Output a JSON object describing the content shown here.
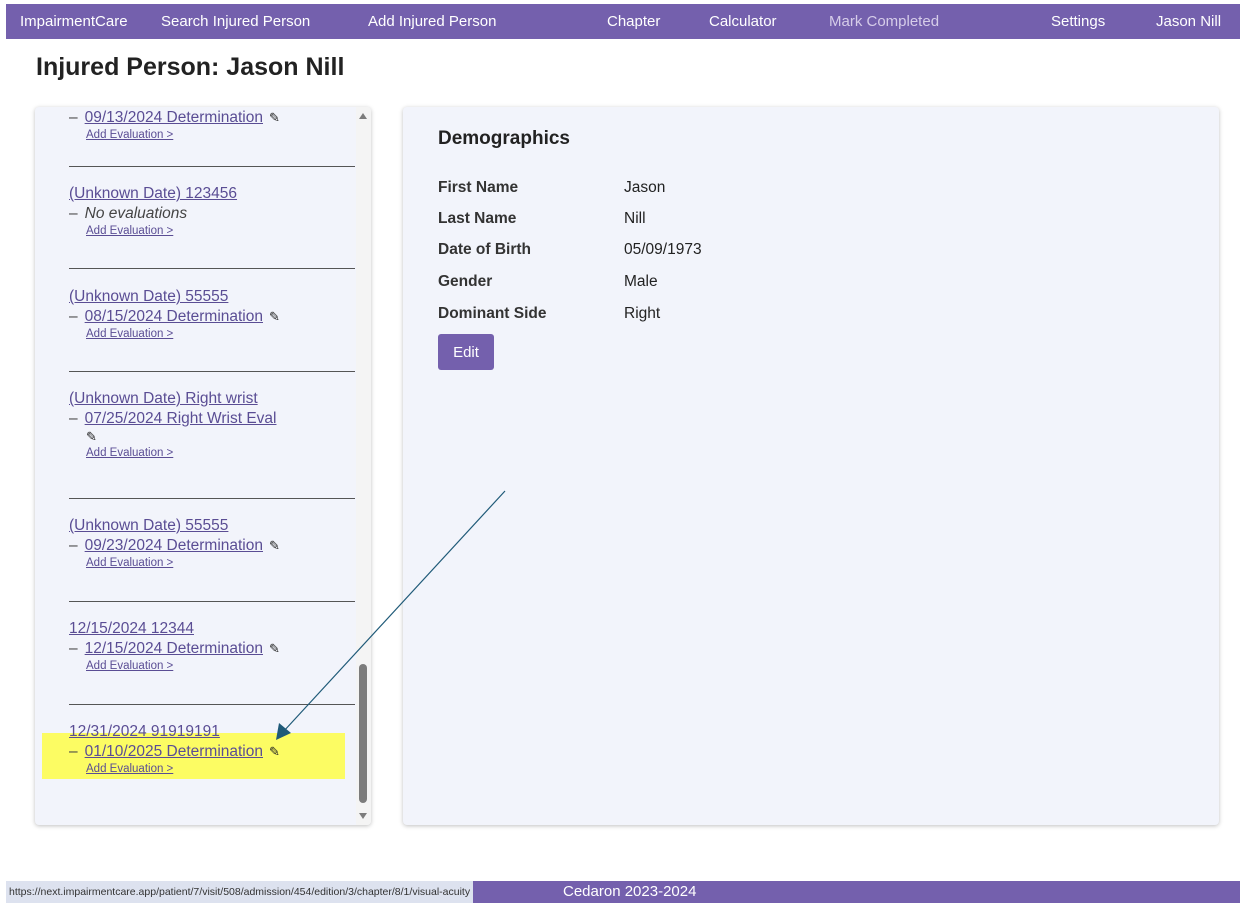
{
  "nav": {
    "brand": "ImpairmentCare",
    "search": "Search Injured Person",
    "add": "Add Injured Person",
    "chapter": "Chapter",
    "calculator": "Calculator",
    "mark_completed": "Mark Completed",
    "settings": "Settings",
    "user": "Jason Nill"
  },
  "page": {
    "title": "Injured Person: Jason Nill"
  },
  "sidebar": {
    "add_evaluation_label": "Add Evaluation >",
    "no_evaluations_label": "No evaluations",
    "admissions": [
      {
        "title": "",
        "evaluation": "09/13/2024 Determination"
      },
      {
        "title": "(Unknown Date) 123456",
        "evaluation": ""
      },
      {
        "title": "(Unknown Date) 55555",
        "evaluation": "08/15/2024 Determination"
      },
      {
        "title": "(Unknown Date) Right wrist",
        "evaluation": "07/25/2024 Right Wrist Eval"
      },
      {
        "title": "(Unknown Date) 55555",
        "evaluation": "09/23/2024 Determination"
      },
      {
        "title": "12/15/2024 12344",
        "evaluation": "12/15/2024 Determination"
      },
      {
        "title": "12/31/2024 91919191",
        "evaluation": "01/10/2025 Determination"
      }
    ]
  },
  "demographics": {
    "heading": "Demographics",
    "rows": [
      {
        "label": "First Name",
        "value": "Jason"
      },
      {
        "label": "Last Name",
        "value": "Nill"
      },
      {
        "label": "Date of Birth",
        "value": "05/09/1973"
      },
      {
        "label": "Gender",
        "value": "Male"
      },
      {
        "label": "Dominant Side",
        "value": "Right"
      }
    ],
    "edit_label": "Edit"
  },
  "footer": {
    "status_url": "https://next.impairmentcare.app/patient/7/visit/508/admission/454/edition/3/chapter/8/1/visual-acuity",
    "copyright": "Cedaron 2023-2024"
  },
  "colors": {
    "brand": "#7460ad",
    "link": "#5a4d94",
    "panel_bg": "#f2f4fb",
    "highlight": "#ffff28",
    "annotation_arrow": "#1f5a78"
  }
}
